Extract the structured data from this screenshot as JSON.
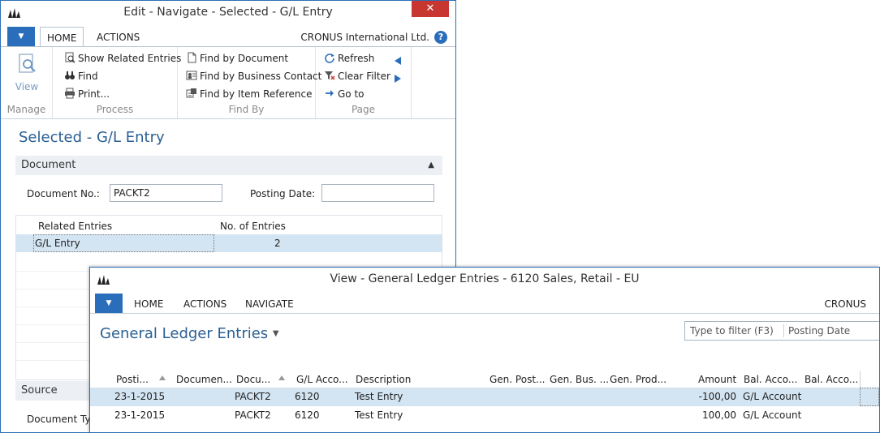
{
  "colors": {
    "accent": "#2a6ebb",
    "heading": "#2a5f94",
    "selected_row": "#d3e4f2",
    "close": "#c7372f"
  },
  "win1": {
    "title": "Edit - Navigate - Selected - G/L Entry",
    "close_glyph": "✕",
    "tabs": {
      "home": "HOME",
      "actions": "ACTIONS"
    },
    "company": "CRONUS International Ltd.",
    "help_glyph": "?",
    "ribbon": {
      "manage": {
        "label": "Manage",
        "view": "View"
      },
      "process": {
        "label": "Process",
        "show_related": "Show Related Entries",
        "find": "Find",
        "print": "Print..."
      },
      "find_by": {
        "label": "Find By",
        "by_document": "Find by Document",
        "by_contact": "Find by Business Contact",
        "by_item_ref": "Find by Item Reference"
      },
      "page": {
        "label": "Page",
        "refresh": "Refresh",
        "clear_filter": "Clear Filter",
        "go_to": "Go to"
      }
    },
    "page_title": "Selected - G/L Entry",
    "document_section": "Document",
    "document_no_label": "Document No.:",
    "document_no_value": "PACKT2",
    "posting_date_label": "Posting Date:",
    "posting_date_value": "",
    "grid": {
      "headers": [
        "Related Entries",
        "No. of Entries"
      ],
      "rows": [
        {
          "entry": "G/L Entry",
          "count": "2"
        }
      ]
    },
    "source_section": "Source",
    "document_type_label": "Document Typ"
  },
  "win2": {
    "title": "View - General Ledger Entries - 6120 Sales, Retail - EU",
    "tabs": {
      "home": "HOME",
      "actions": "ACTIONS",
      "navigate": "NAVIGATE"
    },
    "company": "CRONUS",
    "list_title": "General Ledger Entries",
    "filter_placeholder": "Type to filter (F3)",
    "filter_field": "Posting Date",
    "columns": [
      "Posti...",
      "Documen...",
      "Docu...",
      "G/L Acco...",
      "Description",
      "Gen. Post...",
      "Gen. Bus. ...",
      "Gen. Prod...",
      "Amount",
      "Bal. Acco...",
      "Bal. Acco..."
    ],
    "rows": [
      {
        "posting_date": "23-1-2015",
        "document_no": "PACKT2",
        "gl_account": "6120",
        "description": "Test Entry",
        "amount": "-100,00",
        "bal_account_type": "G/L Account"
      },
      {
        "posting_date": "23-1-2015",
        "document_no": "PACKT2",
        "gl_account": "6120",
        "description": "Test Entry",
        "amount": "100,00",
        "bal_account_type": "G/L Account"
      }
    ]
  }
}
